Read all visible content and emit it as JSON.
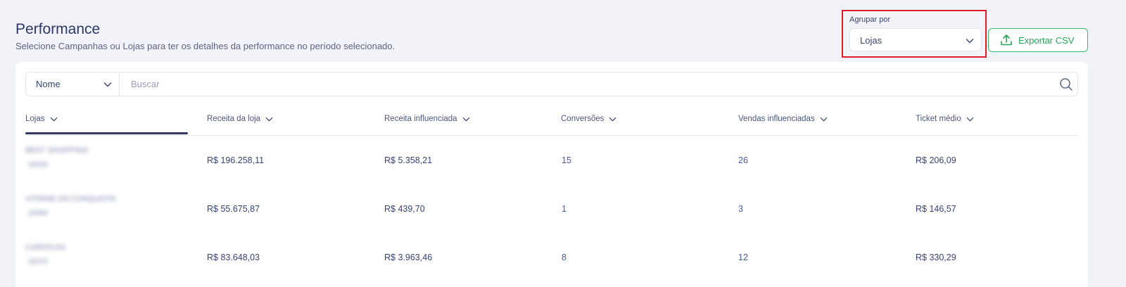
{
  "header": {
    "title": "Performance",
    "subtitle": "Selecione Campanhas ou Lojas para ter os detalhes da performance no período selecionado."
  },
  "group_by": {
    "label": "Agrupar por",
    "selected": "Lojas"
  },
  "export_button": {
    "label": "Exportar CSV"
  },
  "search": {
    "field_selected": "Nome",
    "placeholder": "Buscar"
  },
  "table": {
    "columns": [
      {
        "label": "Lojas"
      },
      {
        "label": "Receita da loja"
      },
      {
        "label": "Receita influenciada"
      },
      {
        "label": "Conversões"
      },
      {
        "label": "Vendas influenciadas"
      },
      {
        "label": "Ticket médio"
      }
    ],
    "rows": [
      {
        "store_name": "BEST SHOPPING",
        "store_id": "32050",
        "receita_loja": "R$ 196.258,11",
        "receita_influenciada": "R$ 5.358,21",
        "conversoes": "15",
        "vendas_influenciadas": "26",
        "ticket_medio": "R$ 206,09"
      },
      {
        "store_name": "VITRINE DA CONQUISTA",
        "store_id": "32060",
        "receita_loja": "R$ 55.675,87",
        "receita_influenciada": "R$ 439,70",
        "conversoes": "1",
        "vendas_influenciadas": "3",
        "ticket_medio": "R$ 146,57"
      },
      {
        "store_name": "CARIOCAS",
        "store_id": "32070",
        "receita_loja": "R$ 83.648,03",
        "receita_influenciada": "R$ 3.963,46",
        "conversoes": "8",
        "vendas_influenciadas": "12",
        "ticket_medio": "R$ 330,29"
      }
    ]
  },
  "colors": {
    "accent": "#2e3766",
    "export_green": "#27a65a",
    "highlight_red": "#e01d25",
    "background": "#f2f3f8"
  },
  "icons": {
    "dropdown": "chevron-down-icon",
    "export": "upload-icon",
    "search": "search-icon"
  }
}
